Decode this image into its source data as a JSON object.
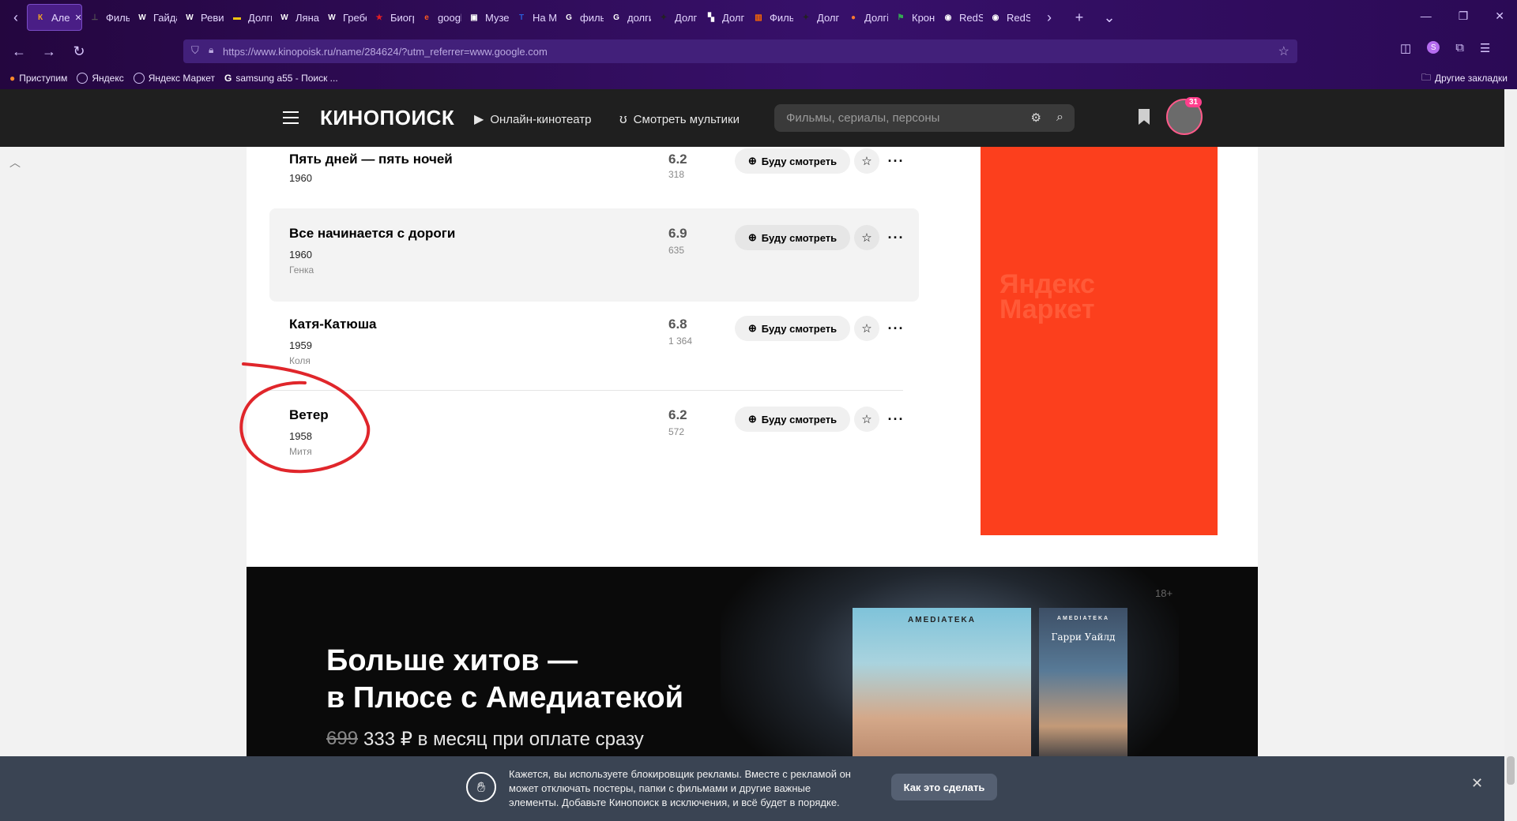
{
  "browser": {
    "tabs": [
      {
        "label": "Але",
        "fav": "К",
        "color": "#f5a623",
        "active": true
      },
      {
        "label": "Филь",
        "fav": "⊥",
        "color": "#555555"
      },
      {
        "label": "Гайда",
        "fav": "W",
        "color": "#ffffff"
      },
      {
        "label": "Ревиз",
        "fav": "W",
        "color": "#ffffff"
      },
      {
        "label": "Долги",
        "fav": "▬",
        "color": "#f2c511"
      },
      {
        "label": "Ляна",
        "fav": "W",
        "color": "#ffffff"
      },
      {
        "label": "Гребе",
        "fav": "W",
        "color": "#ffffff"
      },
      {
        "label": "Биогр",
        "fav": "★",
        "color": "#e31e24"
      },
      {
        "label": "googl",
        "fav": "e",
        "color": "#ff5a1f"
      },
      {
        "label": "Музе",
        "fav": "▣",
        "color": "#ffffff"
      },
      {
        "label": "На Ml",
        "fav": "T",
        "color": "#2a5bd7"
      },
      {
        "label": "филь",
        "fav": "G",
        "color": "#ffffff"
      },
      {
        "label": "долги",
        "fav": "G",
        "color": "#ffffff"
      },
      {
        "label": "Долг",
        "fav": "✦",
        "color": "#222222"
      },
      {
        "label": "Долг",
        "fav": "▚",
        "color": "#ffffff"
      },
      {
        "label": "Филь",
        "fav": "▥",
        "color": "#ff6a00"
      },
      {
        "label": "Долг",
        "fav": "✦",
        "color": "#222222"
      },
      {
        "label": "Долгі",
        "fav": "●",
        "color": "#ff7a2f"
      },
      {
        "label": "Крон",
        "fav": "⚑",
        "color": "#34a853"
      },
      {
        "label": "RedSl",
        "fav": "◉",
        "color": "#ffffff"
      },
      {
        "label": "RedSl",
        "fav": "◉",
        "color": "#ffffff"
      }
    ],
    "url": "https://www.kinopoisk.ru/name/284624/?utm_referrer=www.google.com",
    "bookmarks": [
      "Приступим",
      "Яндекс",
      "Яндекс Маркет",
      "samsung a55 - Поиск ..."
    ],
    "other_bookmarks": "Другие закладки"
  },
  "header": {
    "logo": "КИНОПОИСК",
    "nav_online": "Онлайн-кинотеатр",
    "nav_cartoons": "Смотреть мультики",
    "search_placeholder": "Фильмы, сериалы, персоны",
    "badge": "31"
  },
  "films": [
    {
      "title": "Пять дней — пять ночей",
      "year": "1960",
      "role": "",
      "rating": "6.2",
      "votes": "318"
    },
    {
      "title": "Все начинается с дороги",
      "year": "1960",
      "role": "Генка",
      "rating": "6.9",
      "votes": "635"
    },
    {
      "title": "Катя-Катюша",
      "year": "1959",
      "role": "Коля",
      "rating": "6.8",
      "votes": "1 364"
    },
    {
      "title": "Ветер",
      "year": "1958",
      "role": "Митя",
      "rating": "6.2",
      "votes": "572"
    }
  ],
  "watch_label": "Буду смотреть",
  "ad": {
    "watermark_line1": "Яндекс",
    "watermark_line2": "Маркет",
    "color": "#fc3f1d"
  },
  "promo": {
    "line1": "Больше хитов —",
    "line2": "в Плюсе с Амедиатекой",
    "price_old": "699",
    "price_new": "333 ₽ в месяц при оплате сразу",
    "age": "18+",
    "poster_brand": "AMEDIATEKA",
    "poster_title": "Гарри Уайлд"
  },
  "adblock": {
    "text": "Кажется, вы используете блокировщик рекламы. Вместе с рекламой он может отключать постеры, папки с фильмами и другие важные элементы. Добавьте Кинопоиск в исключения, и всё будет в порядке.",
    "button": "Как это сделать"
  }
}
